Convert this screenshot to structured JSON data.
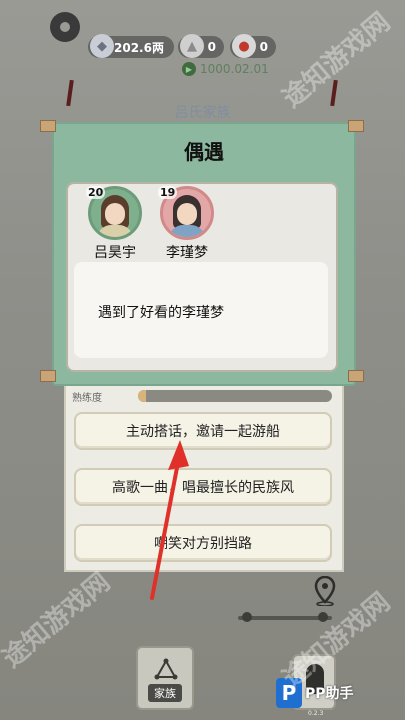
{
  "header": {
    "silver_amount": "202.6两",
    "resource_a": "0",
    "resource_b": "0",
    "date": "1000.02.01"
  },
  "background": {
    "family_title": "吕氏家族",
    "skill_label": "熟练度",
    "skill_progress": 0.04
  },
  "dialog": {
    "title": "偶遇",
    "characters": [
      {
        "name": "吕昊宇",
        "age": "20"
      },
      {
        "name": "李瑾梦",
        "age": "19"
      }
    ],
    "story_text": "遇到了好看的李瑾梦"
  },
  "options": [
    {
      "label": "主动搭话，邀请一起游船"
    },
    {
      "label": "高歌一曲，唱最擅长的民族风"
    },
    {
      "label": "嘲笑对方别挡路"
    }
  ],
  "bottom": {
    "family_button_label": "家族",
    "logo_text": "PP助手",
    "version": "0.2.3"
  },
  "watermark": "途知游戏网",
  "colors": {
    "dialog_bg": "#8db8a0",
    "option_bg": "#f5f2e6",
    "arrow": "#e0302a"
  }
}
